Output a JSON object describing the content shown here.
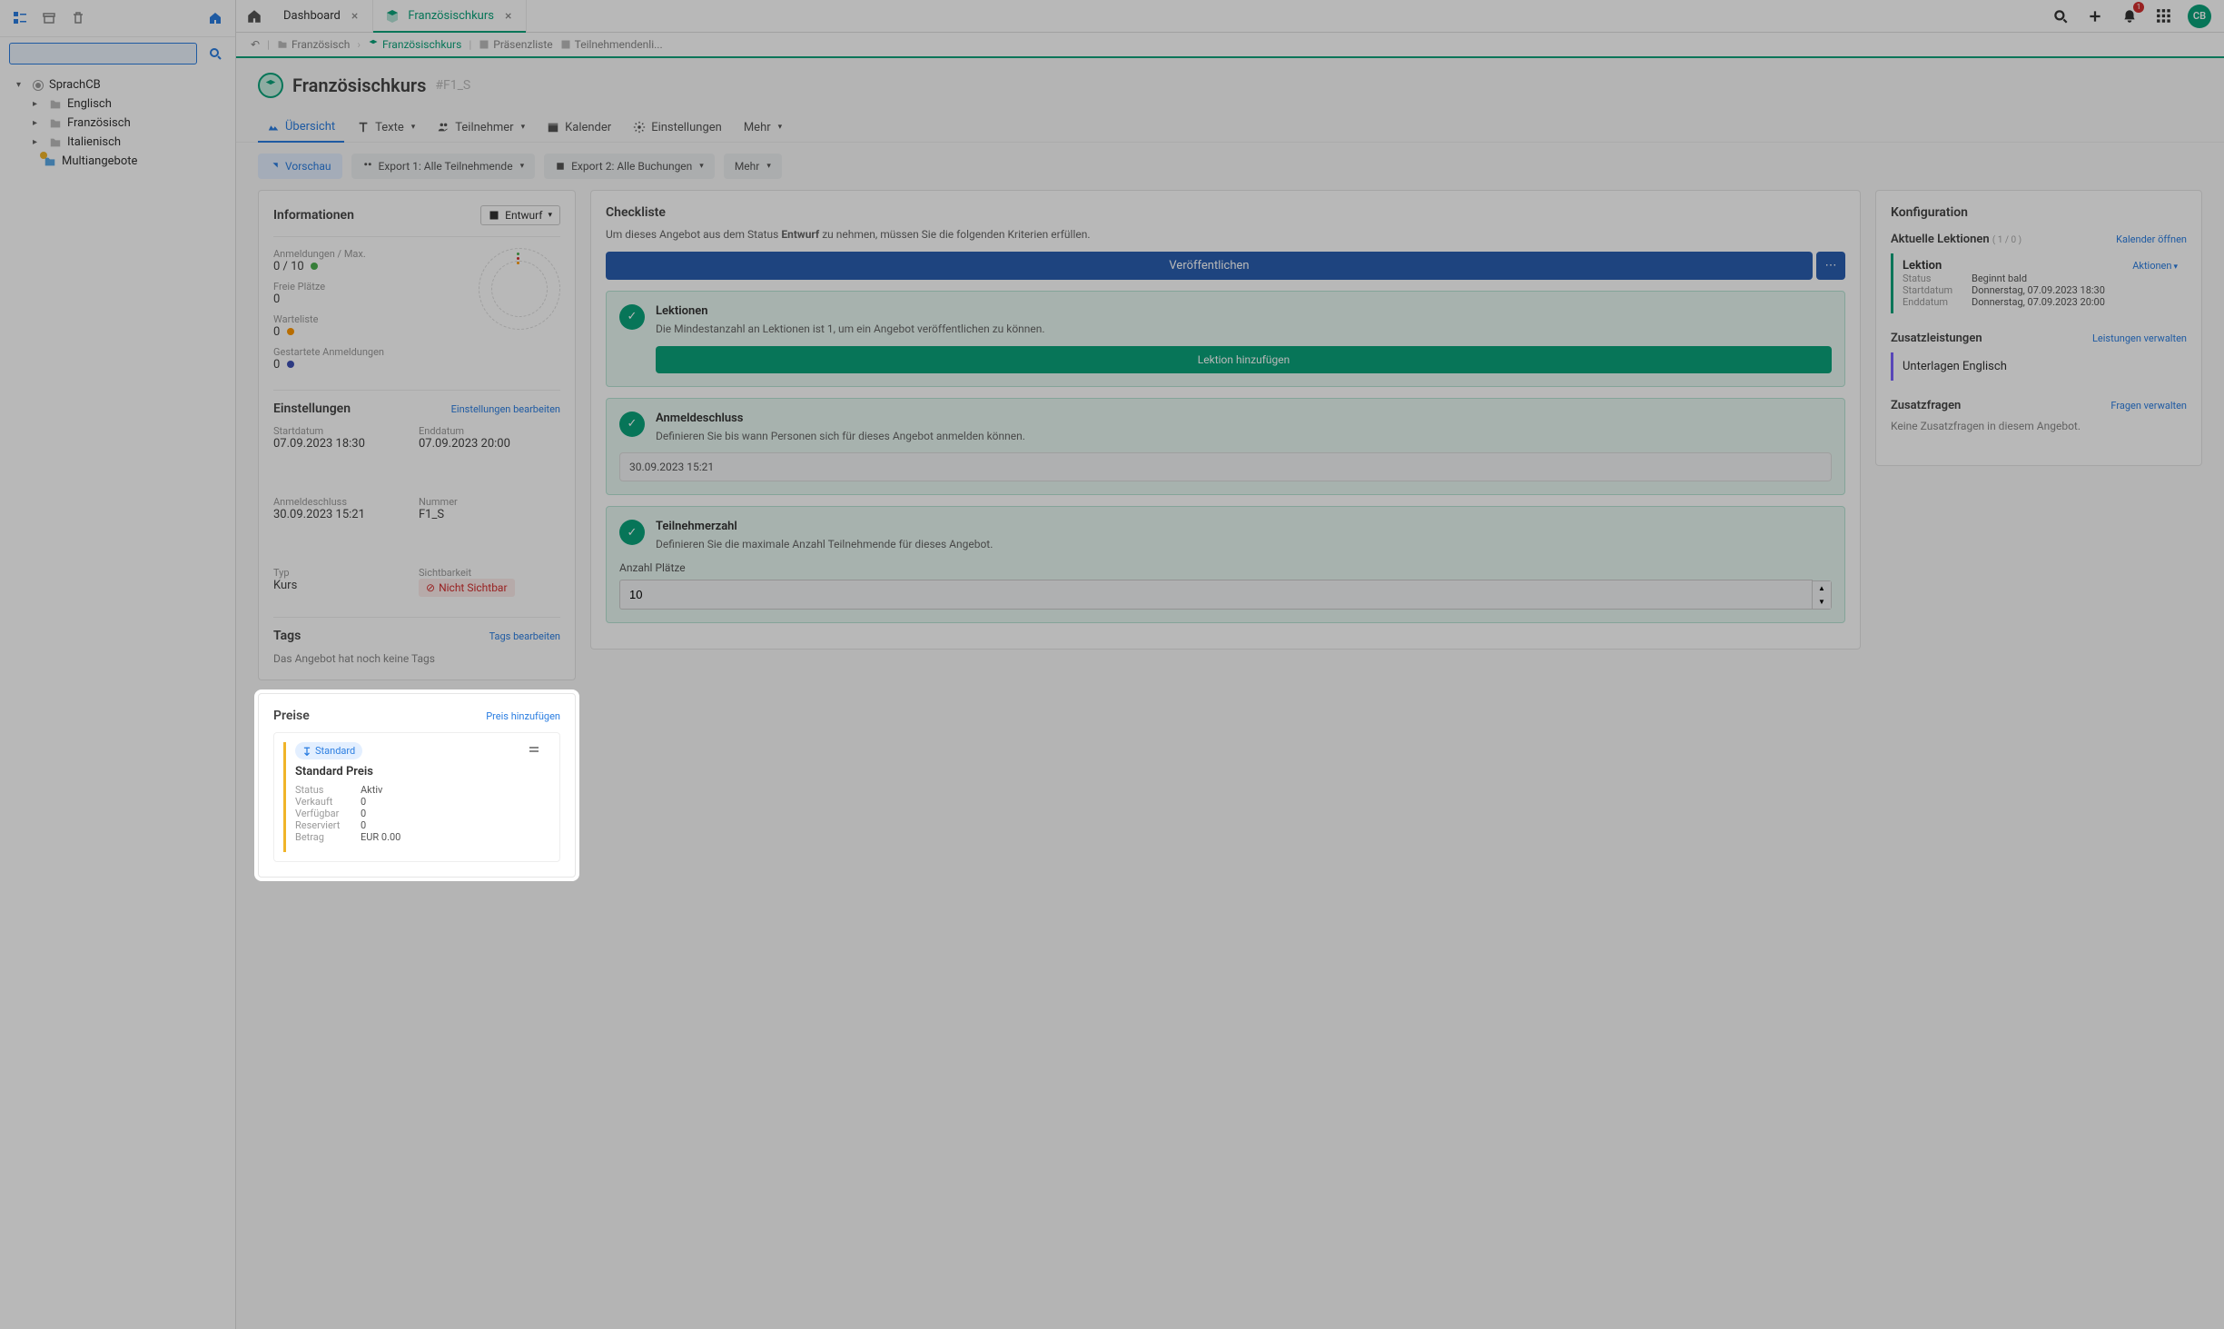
{
  "sidebar": {
    "root": "SprachCB",
    "items": [
      "Englisch",
      "Französisch",
      "Italienisch"
    ],
    "multi": "Multiangebote"
  },
  "tabs": {
    "dashboard": "Dashboard",
    "course": "Französischkurs"
  },
  "topbar": {
    "avatar": "CB",
    "notif_count": "1"
  },
  "breadcrumb": {
    "b1": "Französisch",
    "b2": "Französischkurs",
    "b3": "Präsenzliste",
    "b4": "Teilnehmendenli..."
  },
  "header": {
    "title": "Französischkurs",
    "code": "#F1_S"
  },
  "menu": {
    "overview": "Übersicht",
    "texts": "Texte",
    "participants": "Teilnehmer",
    "calendar": "Kalender",
    "settings": "Einstellungen",
    "more": "Mehr"
  },
  "actions": {
    "preview": "Vorschau",
    "export1": "Export 1: Alle Teilnehmende",
    "export2": "Export 2: Alle Buchungen",
    "more": "Mehr"
  },
  "info": {
    "title": "Informationen",
    "draft": "Entwurf",
    "reg_label": "Anmeldungen / Max.",
    "reg_value": "0 / 10",
    "free_label": "Freie Plätze",
    "free_value": "0",
    "wait_label": "Warteliste",
    "wait_value": "0",
    "started_label": "Gestartete Anmeldungen",
    "started_value": "0",
    "settings_title": "Einstellungen",
    "settings_link": "Einstellungen bearbeiten",
    "start_label": "Startdatum",
    "start_value": "07.09.2023 18:30",
    "end_label": "Enddatum",
    "end_value": "07.09.2023 20:00",
    "close_label": "Anmeldeschluss",
    "close_value": "30.09.2023 15:21",
    "num_label": "Nummer",
    "num_value": "F1_S",
    "type_label": "Typ",
    "type_value": "Kurs",
    "vis_label": "Sichtbarkeit",
    "vis_value": "Nicht Sichtbar",
    "tags_title": "Tags",
    "tags_link": "Tags bearbeiten",
    "tags_empty": "Das Angebot hat noch keine Tags"
  },
  "prices": {
    "title": "Preise",
    "add": "Preis hinzufügen",
    "tag": "Standard",
    "name": "Standard Preis",
    "rows": {
      "status_k": "Status",
      "status_v": "Aktiv",
      "sold_k": "Verkauft",
      "sold_v": "0",
      "avail_k": "Verfügbar",
      "avail_v": "0",
      "res_k": "Reserviert",
      "res_v": "0",
      "amount_k": "Betrag",
      "amount_v": "EUR 0.00"
    }
  },
  "checklist": {
    "title": "Checkliste",
    "desc_a": "Um dieses Angebot aus dem Status ",
    "desc_b": "Entwurf",
    "desc_c": " zu nehmen, müssen Sie die folgenden Kriterien erfüllen.",
    "publish": "Veröffentlichen",
    "lessons_title": "Lektionen",
    "lessons_desc": "Die Mindestanzahl an Lektionen ist 1, um ein Angebot veröffentlichen zu können.",
    "lessons_btn": "Lektion hinzufügen",
    "deadline_title": "Anmeldeschluss",
    "deadline_desc": "Definieren Sie bis wann Personen sich für dieses Angebot anmelden können.",
    "deadline_value": "30.09.2023 15:21",
    "capacity_title": "Teilnehmerzahl",
    "capacity_desc": "Definieren Sie die maximale Anzahl Teilnehmende für dieses Angebot.",
    "capacity_label": "Anzahl Plätze",
    "capacity_value": "10"
  },
  "config": {
    "title": "Konfiguration",
    "lessons_title": "Aktuelle Lektionen",
    "lessons_count": "( 1 / 0 )",
    "lessons_link": "Kalender öffnen",
    "lesson_name": "Lektion",
    "lesson_actions": "Aktionen",
    "lesson_status_k": "Status",
    "lesson_status_v": "Beginnt bald",
    "lesson_start_k": "Startdatum",
    "lesson_start_v": "Donnerstag, 07.09.2023 18:30",
    "lesson_end_k": "Enddatum",
    "lesson_end_v": "Donnerstag, 07.09.2023 20:00",
    "services_title": "Zusatzleistungen",
    "services_link": "Leistungen verwalten",
    "service_name": "Unterlagen Englisch",
    "questions_title": "Zusatzfragen",
    "questions_link": "Fragen verwalten",
    "questions_empty": "Keine Zusatzfragen in diesem Angebot."
  }
}
